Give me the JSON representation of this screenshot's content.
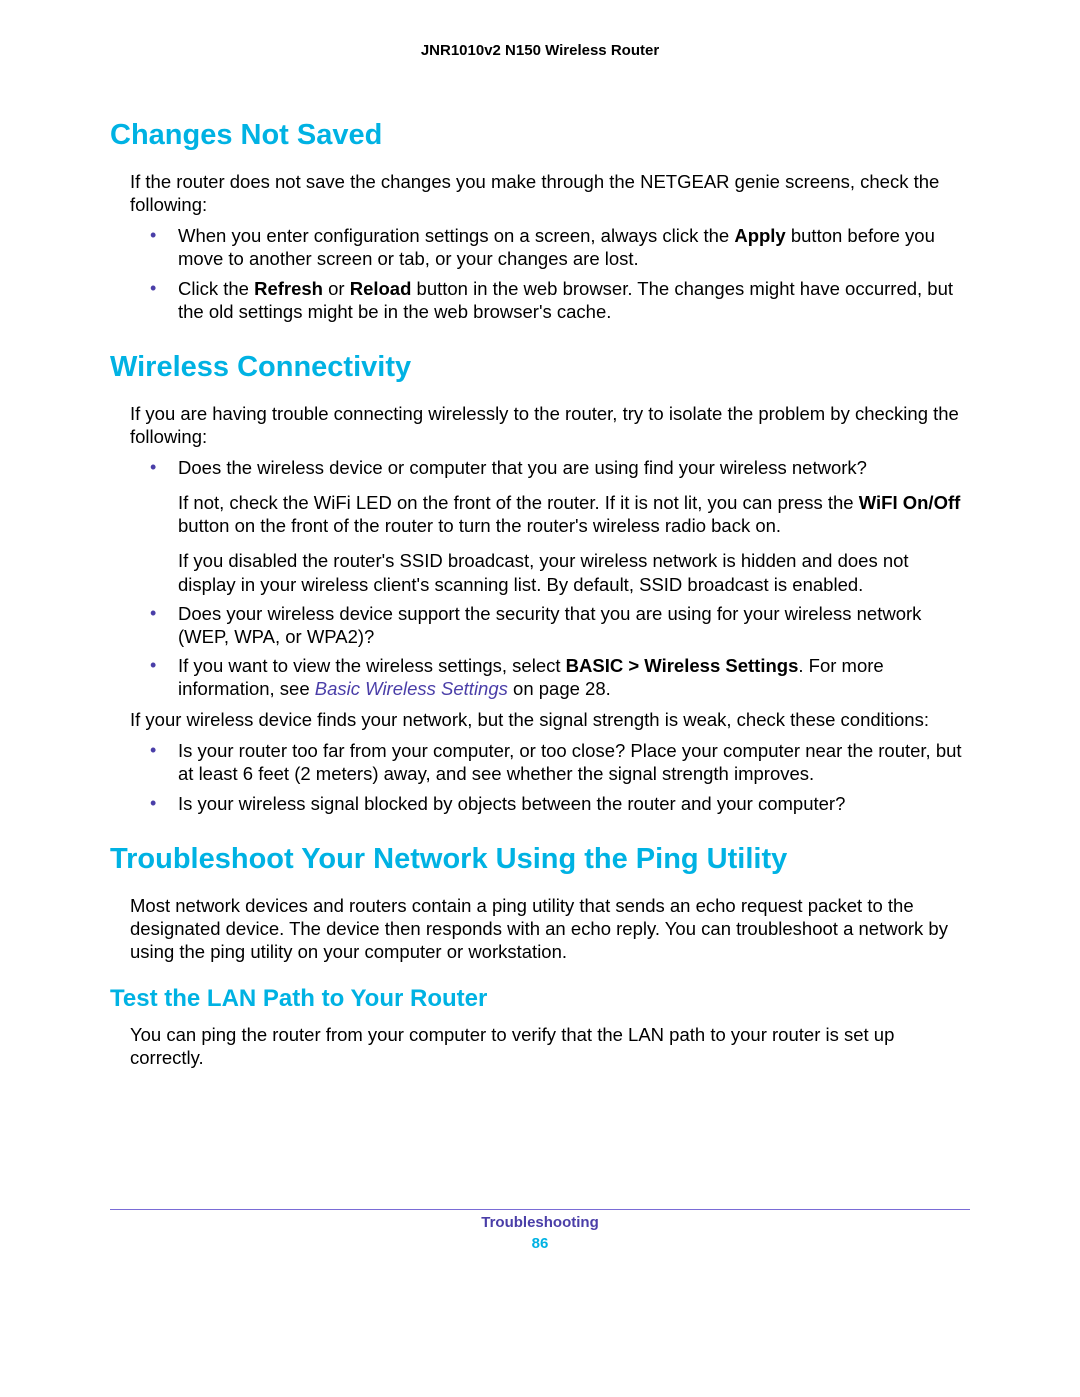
{
  "header": {
    "product": "JNR1010v2 N150 Wireless Router"
  },
  "sections": {
    "s1": {
      "title": "Changes Not Saved",
      "intro": "If the router does not save the changes you make through the NETGEAR genie screens, check the following:",
      "b1_a": "When you enter configuration settings on a screen, always click the ",
      "b1_bold": "Apply",
      "b1_b": " button before you move to another screen or tab, or your changes are lost.",
      "b2_a": "Click the ",
      "b2_bold1": "Refresh",
      "b2_mid": " or ",
      "b2_bold2": "Reload",
      "b2_b": " button in the web browser. The changes might have occurred, but the old settings might be in the web browser's cache."
    },
    "s2": {
      "title": "Wireless Connectivity",
      "intro": "If you are having trouble connecting wirelessly to the router, try to isolate the problem by checking the following:",
      "b1": "Does the wireless device or computer that you are using find your wireless network?",
      "b1_p1_a": "If not, check the WiFi LED on the front of the router. If it is not lit, you can press the ",
      "b1_p1_bold": "WiFI On/Off",
      "b1_p1_b": " button on the front of the router to turn the router's wireless radio back on.",
      "b1_p2": "If you disabled the router's SSID broadcast, your wireless network is hidden and does not display in your wireless client's scanning list. By default, SSID broadcast is enabled.",
      "b2": "Does your wireless device support the security that you are using for your wireless network (WEP, WPA, or WPA2)?",
      "b3_a": "If you want to view the wireless settings, select ",
      "b3_bold": "BASIC > Wireless Settings",
      "b3_b": ". For more information, see ",
      "b3_link": "Basic Wireless Settings",
      "b3_c": " on page 28.",
      "after": "If your wireless device finds your network, but the signal strength is weak, check these conditions:",
      "c1": "Is your router too far from your computer, or too close? Place your computer near the router, but at least 6 feet (2 meters) away, and see whether the signal strength improves.",
      "c2": "Is your wireless signal blocked by objects between the router and your computer?"
    },
    "s3": {
      "title": "Troubleshoot Your Network Using the Ping Utility",
      "intro": "Most network devices and routers contain a ping utility that sends an echo request packet to the designated device. The device then responds with an echo reply. You can troubleshoot a network by using the ping utility on your computer or workstation.",
      "sub1_title": "Test the LAN Path to Your Router",
      "sub1_body": "You can ping the router from your computer to verify that the LAN path to your router is set up correctly."
    }
  },
  "footer": {
    "chapter": "Troubleshooting",
    "page": "86"
  }
}
